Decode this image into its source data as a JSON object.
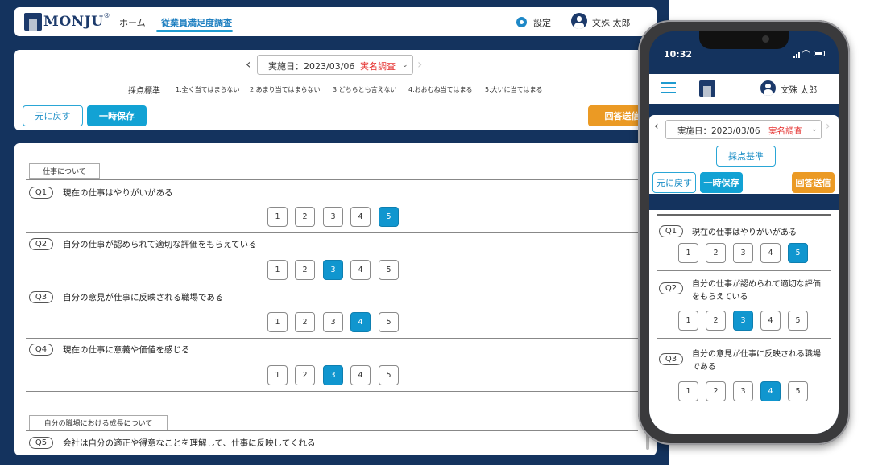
{
  "header": {
    "logo_text": "MONJU",
    "logo_reg": "®",
    "nav": [
      {
        "label": "ホーム"
      },
      {
        "label": "従業員満足度調査"
      }
    ],
    "settings_label": "設定",
    "user_name": "文殊 太郎"
  },
  "toolbar": {
    "date_label": "実施日：2023/03/06",
    "survey_type": "実名調査",
    "criteria_label": "採点標準",
    "criteria": [
      "1.全く当てはまらない",
      "2.あまり当てはまらない",
      "3.どちらとも言えない",
      "4.おおむね当てはまる",
      "5.大いに当てはまる"
    ],
    "back_label": "元に戻す",
    "save_label": "一時保存",
    "submit_label": "回答送信"
  },
  "survey": {
    "sections": [
      {
        "title": "仕事について",
        "questions": [
          {
            "id": "Q1",
            "text": "現在の仕事はやりがいがある",
            "selected": 5
          },
          {
            "id": "Q2",
            "text": "自分の仕事が認められて適切な評価をもらえている",
            "selected": 3
          },
          {
            "id": "Q3",
            "text": "自分の意見が仕事に反映される職場である",
            "selected": 4
          },
          {
            "id": "Q4",
            "text": "現在の仕事に意義や価値を感じる",
            "selected": 3
          }
        ]
      },
      {
        "title": "自分の職場における成長について",
        "questions": [
          {
            "id": "Q5",
            "text": "会社は自分の適正や得意なことを理解して、仕事に反映してくれる",
            "selected": null
          }
        ]
      }
    ],
    "choices": [
      "1",
      "2",
      "3",
      "4",
      "5"
    ]
  },
  "mobile": {
    "status_time": "10:32",
    "user_name": "文殊 太郎",
    "date_label": "実施日：2023/03/06",
    "survey_type": "実名調査",
    "criteria_button": "採点基準",
    "back_label": "元に戻す",
    "save_label": "一時保存",
    "submit_label": "回答送信",
    "questions": [
      {
        "id": "Q1",
        "text": "現在の仕事はやりがいがある",
        "selected": 5
      },
      {
        "id": "Q2",
        "text_line1": "自分の仕事が認められて適切な評価",
        "text_line2": "をもらえている",
        "selected": 3
      },
      {
        "id": "Q3",
        "text_line1": "自分の意見が仕事に反映される職場",
        "text_line2": "である",
        "selected": 4
      }
    ]
  },
  "colors": {
    "navy": "#14335e",
    "accent_blue": "#12a2d4",
    "orange": "#eb9a24",
    "red": "#e5312f"
  }
}
